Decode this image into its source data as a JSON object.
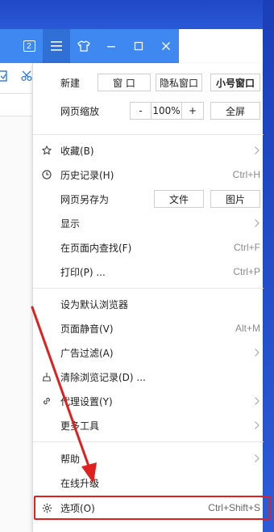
{
  "titlebar": {
    "tab_count": "2",
    "buttons": [
      "menu",
      "skin",
      "minimize",
      "maximize",
      "close"
    ]
  },
  "menu": {
    "new_row": {
      "label": "新建",
      "window": "窗 口",
      "private_window": "隐私窗口",
      "small_window": "小号窗口"
    },
    "zoom_row": {
      "label": "网页缩放",
      "minus": "-",
      "value": "100%",
      "plus": "+",
      "fullscreen": "全屏"
    },
    "favorites": {
      "label": "收藏(B)",
      "icon": "star-icon"
    },
    "history": {
      "label": "历史记录(H)",
      "shortcut": "Ctrl+H",
      "icon": "clock-icon"
    },
    "save_as": {
      "label": "网页另存为",
      "file": "文件",
      "image": "图片"
    },
    "display": {
      "label": "显示"
    },
    "find": {
      "label": "在页面内查找(F)",
      "shortcut": "Ctrl+F"
    },
    "print": {
      "label": "打印(P) ...",
      "shortcut": "Ctrl+P"
    },
    "default_browser": {
      "label": "设为默认浏览器"
    },
    "mute": {
      "label": "页面静音(V)",
      "shortcut": "Alt+M"
    },
    "ad_filter": {
      "label": "广告过滤(A)"
    },
    "clear_data": {
      "label": "清除浏览记录(D) ...",
      "icon": "broom-icon"
    },
    "proxy": {
      "label": "代理设置(Y)",
      "icon": "link-icon"
    },
    "more_tools": {
      "label": "更多工具"
    },
    "help": {
      "label": "帮助"
    },
    "upgrade": {
      "label": "在线升级"
    },
    "options": {
      "label": "选项(O)",
      "shortcut": "Ctrl+Shift+S",
      "icon": "gear-icon"
    }
  },
  "colors": {
    "titlebar": "#3f87f1",
    "annotation": "#e02020"
  }
}
